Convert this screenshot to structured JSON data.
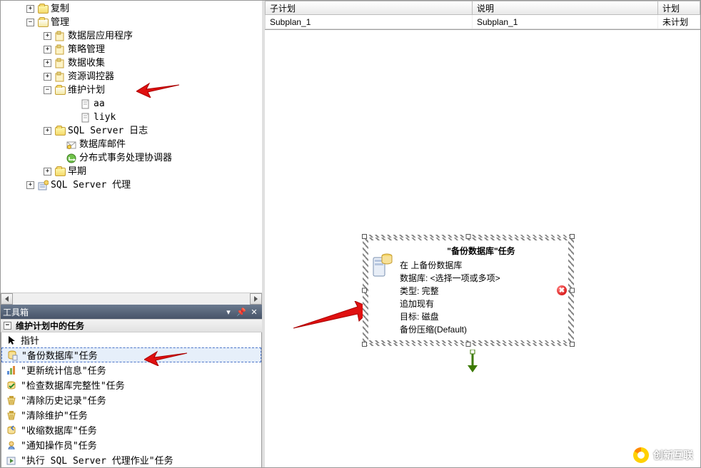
{
  "tree": [
    {
      "indent": 32,
      "pm": "+",
      "icon": "folder-closed",
      "label": "复制"
    },
    {
      "indent": 32,
      "pm": "-",
      "icon": "folder-open",
      "label": "管理"
    },
    {
      "indent": 56,
      "pm": "+",
      "icon": "generic",
      "label": "数据层应用程序"
    },
    {
      "indent": 56,
      "pm": "+",
      "icon": "generic",
      "label": "策略管理"
    },
    {
      "indent": 56,
      "pm": "+",
      "icon": "generic",
      "label": "数据收集"
    },
    {
      "indent": 56,
      "pm": "+",
      "icon": "generic",
      "label": "资源调控器"
    },
    {
      "indent": 56,
      "pm": "-",
      "icon": "folder-open",
      "label": "维护计划",
      "arrow": true
    },
    {
      "indent": 92,
      "pm": "",
      "icon": "doc",
      "label": "aa"
    },
    {
      "indent": 92,
      "pm": "",
      "icon": "doc",
      "label": "liyk"
    },
    {
      "indent": 56,
      "pm": "+",
      "icon": "folder-closed",
      "label": "SQL Server 日志"
    },
    {
      "indent": 72,
      "pm": "",
      "icon": "mail",
      "label": "数据库邮件"
    },
    {
      "indent": 72,
      "pm": "",
      "icon": "dtc",
      "label": "分布式事务处理协调器"
    },
    {
      "indent": 56,
      "pm": "+",
      "icon": "folder-closed",
      "label": "早期"
    },
    {
      "indent": 32,
      "pm": "+",
      "icon": "agent",
      "label": "SQL Server 代理"
    }
  ],
  "toolbox": {
    "title": "工具箱",
    "group": "维护计划中的任务",
    "items": [
      {
        "icon": "pointer",
        "label": "指针"
      },
      {
        "icon": "backup",
        "label": "\"备份数据库\"任务",
        "selected": true,
        "arrow": true
      },
      {
        "icon": "stats",
        "label": "\"更新统计信息\"任务"
      },
      {
        "icon": "check",
        "label": "\"检查数据库完整性\"任务"
      },
      {
        "icon": "clean",
        "label": "\"清除历史记录\"任务"
      },
      {
        "icon": "clean",
        "label": "\"清除维护\"任务"
      },
      {
        "icon": "shrink",
        "label": "\"收缩数据库\"任务"
      },
      {
        "icon": "notify",
        "label": "\"通知操作员\"任务"
      },
      {
        "icon": "job",
        "label": "\"执行 SQL Server 代理作业\"任务"
      }
    ]
  },
  "grid": {
    "headers": [
      "子计划",
      "说明",
      "计划"
    ],
    "row": [
      "Subplan_1",
      "Subplan_1",
      "未计划"
    ]
  },
  "task": {
    "title": "\"备份数据库\"任务",
    "lines": [
      "在  上备份数据库",
      "数据库: <选择一项或多项>",
      "类型: 完整",
      "追加现有",
      "目标: 磁盘",
      "备份压缩(Default)"
    ]
  },
  "brand": "创新互联"
}
